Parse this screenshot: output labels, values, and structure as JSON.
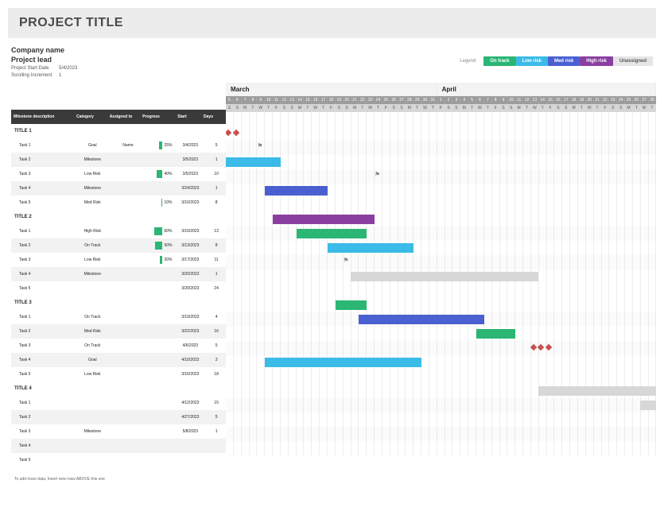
{
  "title": "PROJECT TITLE",
  "company": "Company name",
  "lead": "Project lead",
  "meta": [
    {
      "label": "Project Start Date",
      "value": "5/4/2023"
    },
    {
      "label": "Scrolling Increment",
      "value": "1"
    }
  ],
  "legend": {
    "label": "Legend",
    "items": [
      {
        "text": "On track",
        "color": "#2bb673"
      },
      {
        "text": "Low risk",
        "color": "#3bbbe8"
      },
      {
        "text": "Med risk",
        "color": "#4a5fd0"
      },
      {
        "text": "High risk",
        "color": "#8a3fa0"
      },
      {
        "text": "Unassigned",
        "color": "#e5e5e5",
        "fg": "#555"
      }
    ]
  },
  "columns": {
    "desc": "Milestone description",
    "cat": "Category",
    "ass": "Assigned to",
    "prog": "Progress",
    "start": "Start",
    "days": "Days"
  },
  "timeline": {
    "months": [
      {
        "name": "March",
        "span": 27
      },
      {
        "name": "April",
        "span": 28
      }
    ],
    "startDay": 5,
    "totalDays": 55,
    "dow": [
      "S",
      "S",
      "M",
      "T",
      "W",
      "T",
      "F"
    ]
  },
  "footnote": "To add more data, Insert new rows ABOVE this one",
  "chart_data": {
    "type": "gantt",
    "x_unit": "day",
    "x_start": "2023-03-05",
    "x_end": "2023-04-28",
    "groups": [
      {
        "title": "TITLE 1",
        "tasks": [
          {
            "name": "Task 1",
            "category": "Goal",
            "assigned": "Name",
            "progress": 25,
            "start": "3/4/2023",
            "days": 5,
            "bar": null,
            "markers": [
              0,
              1
            ],
            "color": "#c94f4f"
          },
          {
            "name": "Task 2",
            "category": "Milestone",
            "assigned": "",
            "progress": null,
            "start": "3/5/2023",
            "days": 1,
            "bar": null,
            "flag": 4
          },
          {
            "name": "Task 3",
            "category": "Low Risk",
            "assigned": "",
            "progress": 40,
            "start": "3/5/2023",
            "days": 10,
            "bar": {
              "from": 0,
              "len": 7,
              "color": "#3bbbe8"
            }
          },
          {
            "name": "Task 4",
            "category": "Milestone",
            "assigned": "",
            "progress": null,
            "start": "3/24/2023",
            "days": 1,
            "bar": null,
            "flag": 19
          },
          {
            "name": "Task 5",
            "category": "Med Risk",
            "assigned": "",
            "progress": 10,
            "start": "3/10/2023",
            "days": 8,
            "bar": {
              "from": 5,
              "len": 8,
              "color": "#4a5fd0"
            }
          }
        ]
      },
      {
        "title": "TITLE 2",
        "tasks": [
          {
            "name": "Task 1",
            "category": "High Risk",
            "assigned": "",
            "progress": 60,
            "start": "3/10/2023",
            "days": 13,
            "bar": {
              "from": 6,
              "len": 13,
              "color": "#8a3fa0"
            }
          },
          {
            "name": "Task 2",
            "category": "On Track",
            "assigned": "",
            "progress": 50,
            "start": "3/13/2023",
            "days": 8,
            "bar": {
              "from": 9,
              "len": 9,
              "color": "#2bb673"
            }
          },
          {
            "name": "Task 3",
            "category": "Low Risk",
            "assigned": "",
            "progress": 20,
            "start": "3/17/2023",
            "days": 11,
            "bar": {
              "from": 13,
              "len": 11,
              "color": "#3bbbe8"
            }
          },
          {
            "name": "Task 4",
            "category": "Milestone",
            "assigned": "",
            "progress": null,
            "start": "3/20/2023",
            "days": 1,
            "bar": null,
            "flag": 15
          },
          {
            "name": "Task 5",
            "category": "",
            "assigned": "",
            "progress": null,
            "start": "3/20/2023",
            "days": 24,
            "bar": {
              "from": 16,
              "len": 24,
              "color": "#d7d7d7"
            }
          }
        ]
      },
      {
        "title": "TITLE 3",
        "tasks": [
          {
            "name": "Task 1",
            "category": "On Track",
            "assigned": "",
            "progress": null,
            "start": "3/19/2023",
            "days": 4,
            "bar": {
              "from": 14,
              "len": 4,
              "color": "#2bb673"
            }
          },
          {
            "name": "Task 2",
            "category": "Med Risk",
            "assigned": "",
            "progress": null,
            "start": "3/22/2023",
            "days": 16,
            "bar": {
              "from": 17,
              "len": 16,
              "color": "#4a5fd0"
            }
          },
          {
            "name": "Task 3",
            "category": "On Track",
            "assigned": "",
            "progress": null,
            "start": "4/6/2023",
            "days": 5,
            "bar": {
              "from": 32,
              "len": 5,
              "color": "#2bb673"
            }
          },
          {
            "name": "Task 4",
            "category": "Goal",
            "assigned": "",
            "progress": null,
            "start": "4/10/2023",
            "days": 3,
            "bar": null,
            "markers": [
              39,
              40,
              41
            ],
            "color": "#c94f4f"
          },
          {
            "name": "Task 5",
            "category": "Low Risk",
            "assigned": "",
            "progress": null,
            "start": "3/10/2023",
            "days": 18,
            "bar": {
              "from": 5,
              "len": 20,
              "color": "#3bbbe8"
            }
          }
        ]
      },
      {
        "title": "TITLE 4",
        "tasks": [
          {
            "name": "Task 1",
            "category": "",
            "assigned": "",
            "progress": null,
            "start": "4/12/2023",
            "days": 15,
            "bar": {
              "from": 40,
              "len": 15,
              "color": "#d7d7d7"
            }
          },
          {
            "name": "Task 2",
            "category": "",
            "assigned": "",
            "progress": null,
            "start": "4/27/2023",
            "days": 5,
            "bar": {
              "from": 53,
              "len": 5,
              "color": "#d7d7d7"
            }
          },
          {
            "name": "Task 3",
            "category": "Milestone",
            "assigned": "",
            "progress": null,
            "start": "5/8/2023",
            "days": 1,
            "bar": null
          },
          {
            "name": "Task 4",
            "category": "",
            "assigned": "",
            "progress": null,
            "start": "",
            "days": "",
            "bar": null
          },
          {
            "name": "Task 5",
            "category": "",
            "assigned": "",
            "progress": null,
            "start": "",
            "days": "",
            "bar": null
          }
        ]
      }
    ]
  }
}
